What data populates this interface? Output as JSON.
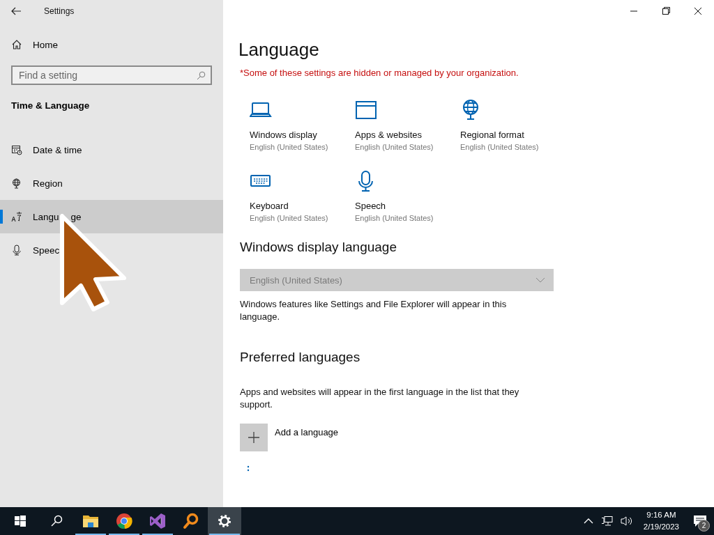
{
  "window": {
    "title": "Settings"
  },
  "sidebar": {
    "home": "Home",
    "search": {
      "placeholder": "Find a setting"
    },
    "section": "Time & Language",
    "items": [
      {
        "label": "Date & time",
        "selected": false
      },
      {
        "label": "Region",
        "selected": false
      },
      {
        "label": "Langu",
        "label_tail": "ge",
        "selected": true
      },
      {
        "label": "Speec",
        "selected": false
      }
    ]
  },
  "main": {
    "title": "Language",
    "notice": "*Some of these settings are hidden or managed by your organization.",
    "tiles": [
      {
        "title": "Windows display",
        "subtitle": "English (United States)"
      },
      {
        "title": "Apps & websites",
        "subtitle": "English (United States)"
      },
      {
        "title": "Regional format",
        "subtitle": "English (United States)"
      },
      {
        "title": "Keyboard",
        "subtitle": "English (United States)"
      },
      {
        "title": "Speech",
        "subtitle": "English (United States)"
      }
    ],
    "display_language": {
      "heading": "Windows display language",
      "value": "English (United States)",
      "disabled": true,
      "description": "Windows features like Settings and File Explorer will appear in this language."
    },
    "preferred": {
      "heading": "Preferred languages",
      "description": "Apps and websites will appear in the first language in the list that they support.",
      "add_label": "Add a language"
    }
  },
  "taskbar": {
    "apps": [
      {
        "running": false,
        "selected": false
      },
      {
        "running": true,
        "selected": false
      },
      {
        "running": true,
        "selected": false
      },
      {
        "running": true,
        "selected": false
      },
      {
        "running": false,
        "selected": false
      },
      {
        "running": true,
        "selected": true
      }
    ],
    "time": "9:16 AM",
    "date": "2/19/2023",
    "notifications": "2"
  }
}
